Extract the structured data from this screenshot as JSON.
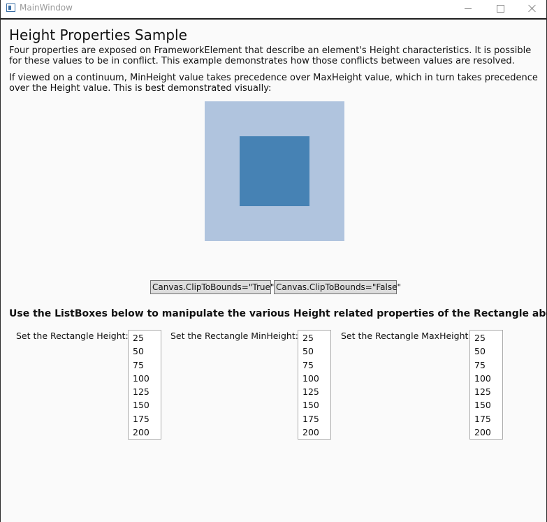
{
  "window": {
    "title": "MainWindow"
  },
  "content": {
    "heading": "Height Properties Sample",
    "paragraph1": "Four properties are exposed on FrameworkElement that describe an element's Height characteristics. It is possible for these values to be in conflict. This example demonstrates how those conflicts between values are resolved.",
    "paragraph2": "If viewed on a continuum, MinHeight value takes precedence over MaxHeight value, which in turn takes precedence over the Height value. This is best demonstrated visually:",
    "buttons": {
      "clip_true": "Canvas.ClipToBounds=\"True\"",
      "clip_false": "Canvas.ClipToBounds=\"False\""
    },
    "instruction": "Use the ListBoxes below to manipulate the various Height related properties of the Rectangle above.",
    "listboxes": [
      {
        "label": "Set the Rectangle Height:",
        "items": [
          "25",
          "50",
          "75",
          "100",
          "125",
          "150",
          "175",
          "200"
        ]
      },
      {
        "label": "Set the Rectangle MinHeight:",
        "items": [
          "25",
          "50",
          "75",
          "100",
          "125",
          "150",
          "175",
          "200"
        ]
      },
      {
        "label": "Set the Rectangle MaxHeight:",
        "items": [
          "25",
          "50",
          "75",
          "100",
          "125",
          "150",
          "175",
          "200"
        ]
      }
    ]
  },
  "colors": {
    "outer_rect": "#b0c4de",
    "inner_rect": "#4682b4"
  }
}
